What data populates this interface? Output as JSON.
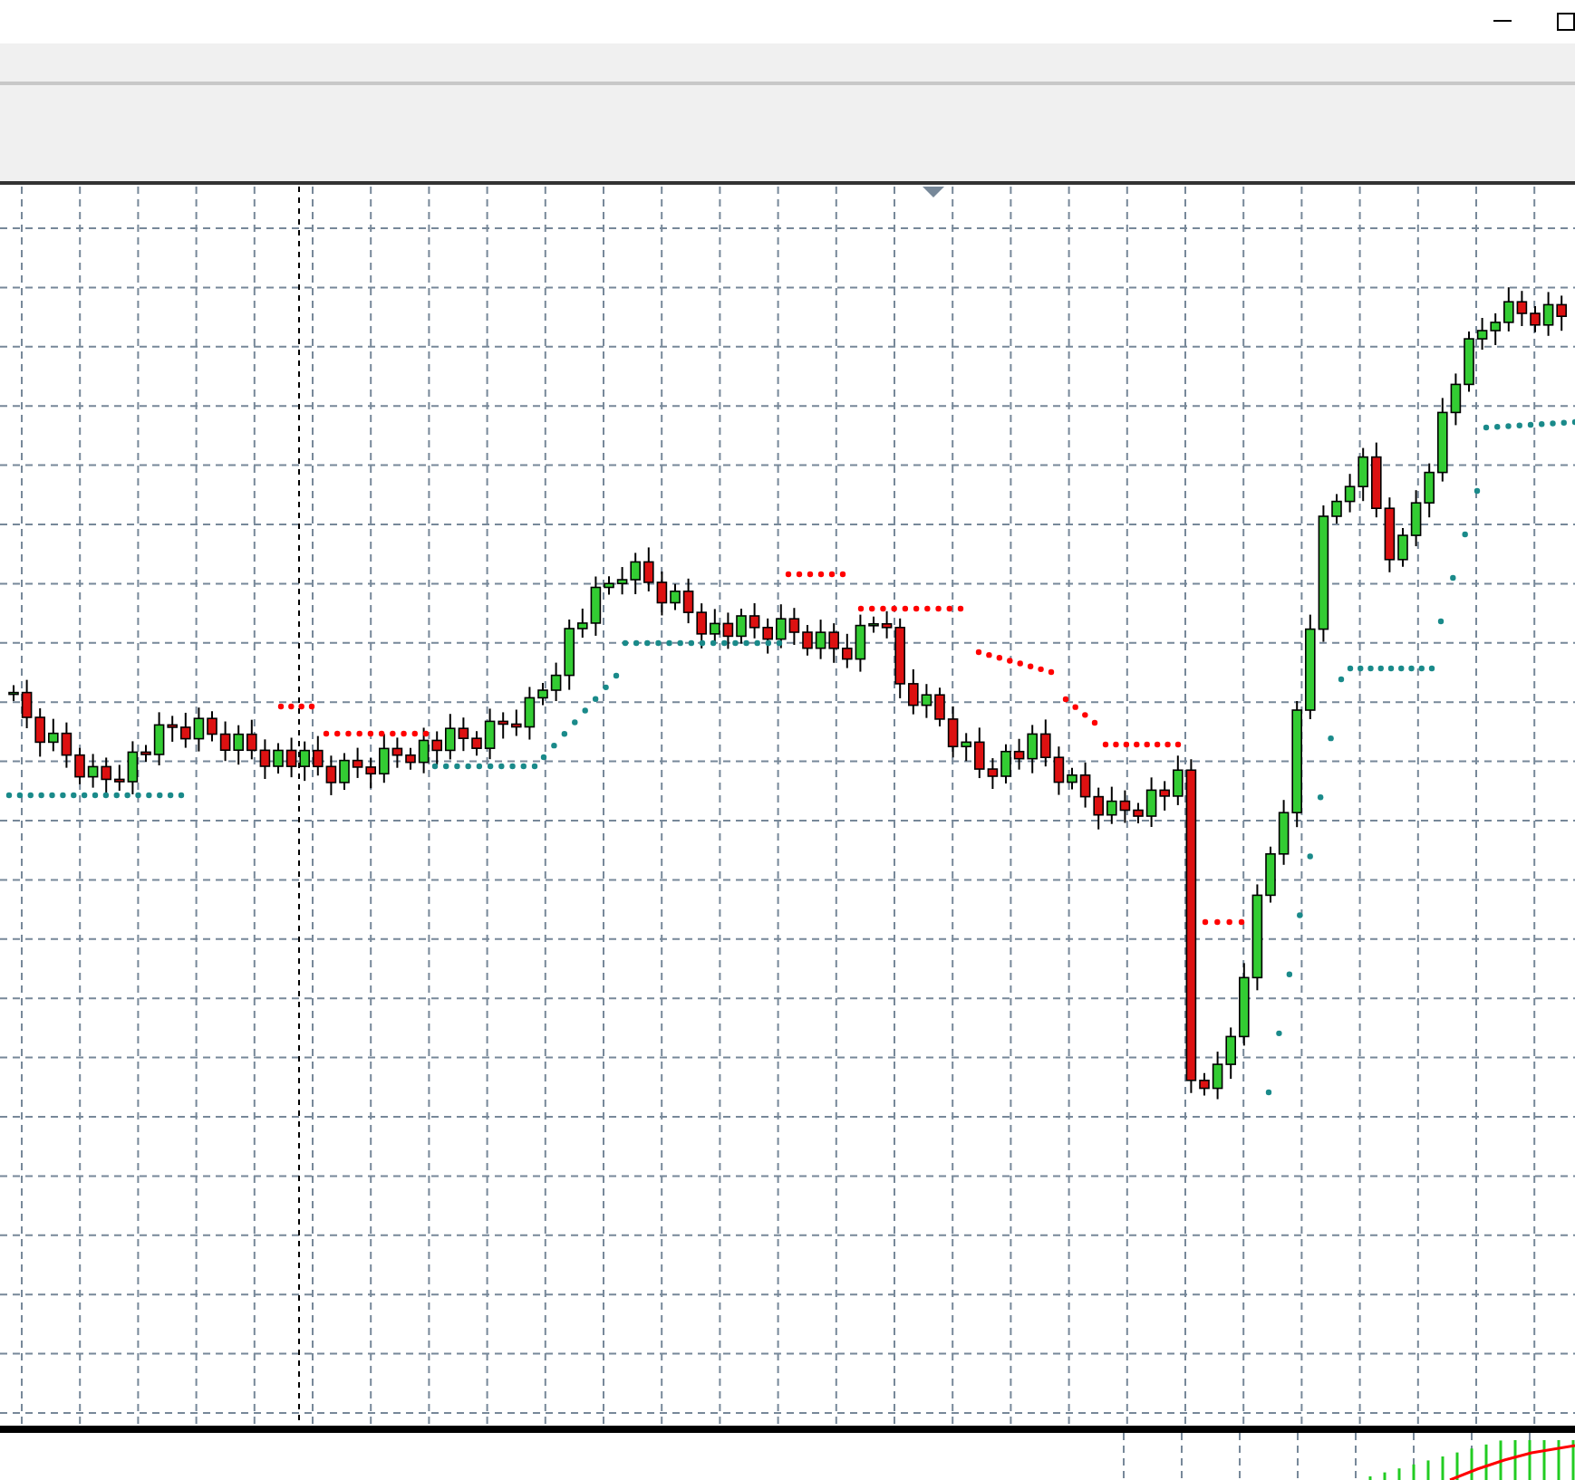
{
  "window": {
    "controls": [
      {
        "kind": "minimize"
      },
      {
        "kind": "maximize"
      }
    ]
  }
}
